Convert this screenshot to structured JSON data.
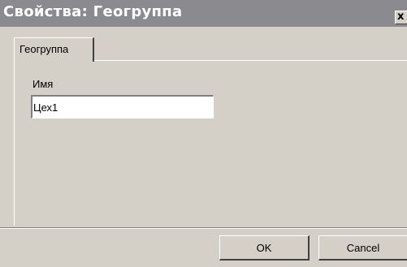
{
  "window": {
    "title": "Свойства: Геогруппа",
    "close_glyph": "x"
  },
  "tabs": [
    {
      "label": "Геогруппа",
      "selected": true
    }
  ],
  "form": {
    "name_label": "Имя",
    "name_value": "Цех1"
  },
  "buttons": {
    "ok_label": "OK",
    "cancel_label": "Cancel"
  },
  "colors": {
    "titlebar": "#8b8a8e",
    "dialog_face": "#d4d0c8",
    "input_background": "#ffffff"
  }
}
